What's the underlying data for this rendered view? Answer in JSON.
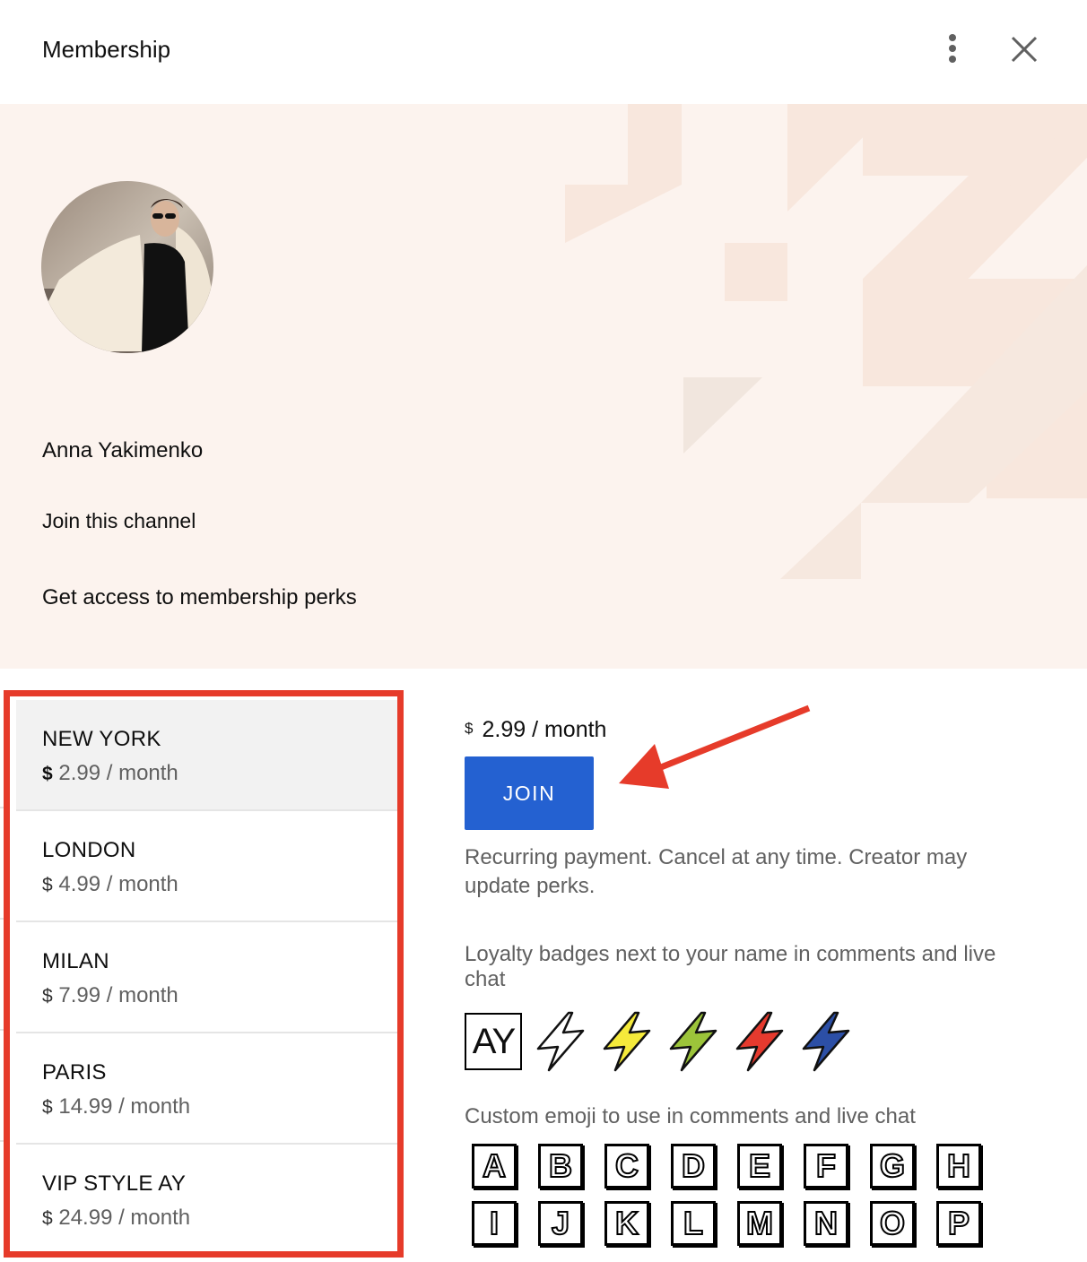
{
  "header": {
    "title": "Membership"
  },
  "banner": {
    "channel_name": "Anna Yakimenko",
    "join_text": "Join this channel",
    "perks_text": "Get access to membership perks"
  },
  "tiers": [
    {
      "name": "NEW YORK",
      "currency": "$",
      "price": "2.99 / month",
      "selected": true
    },
    {
      "name": "LONDON",
      "currency": "$",
      "price": "4.99 / month",
      "selected": false
    },
    {
      "name": "MILAN",
      "currency": "$",
      "price": "7.99 / month",
      "selected": false
    },
    {
      "name": "PARIS",
      "currency": "$",
      "price": "14.99 / month",
      "selected": false
    },
    {
      "name": "VIP STYLE AY",
      "currency": "$",
      "price": "24.99 / month",
      "selected": false
    }
  ],
  "details": {
    "currency": "$",
    "price": "2.99 / month",
    "join_label": "JOIN",
    "recurring_text": "Recurring payment. Cancel at any time. Creator may update perks.",
    "loyalty_text": "Loyalty badges next to your name in comments and live chat",
    "badge_monogram": "AY",
    "badge_colors": [
      "#ffffff",
      "#f5ea3b",
      "#9cc43a",
      "#e53a2e",
      "#2c4fa6"
    ],
    "emoji_text": "Custom emoji to use in comments and live chat",
    "emoji_letters": [
      "A",
      "B",
      "C",
      "D",
      "E",
      "F",
      "G",
      "H",
      "I",
      "J",
      "K",
      "L",
      "M",
      "N",
      "O",
      "P"
    ]
  },
  "colors": {
    "accent": "#2461d1",
    "highlight_border": "#e63b2a",
    "banner_bg": "#fcf3ee"
  },
  "icons": {
    "menu": "kebab-menu-icon",
    "close": "close-icon",
    "annotation": "red-arrow-icon"
  }
}
